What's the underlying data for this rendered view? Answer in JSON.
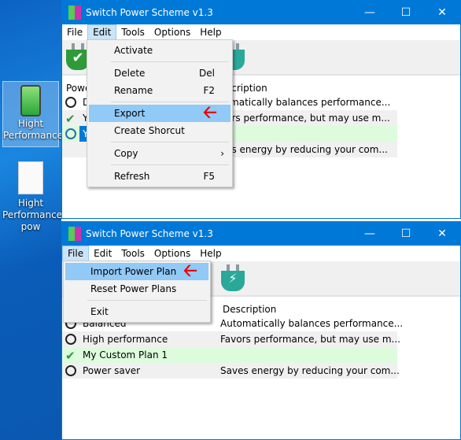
{
  "desktop": {
    "icons": [
      {
        "label": "Hight Performance",
        "icon": "battery-plug-shortcut-icon",
        "selected": true
      },
      {
        "label": "Hight Performance. pow",
        "icon": "file-icon",
        "selected": false
      }
    ]
  },
  "colors": {
    "titlebar": "#0078d7",
    "menu_highlight": "#91c9f7",
    "active_row": "#dcfcdc",
    "alt_row": "#f0f0f0",
    "arrow": "#e00000"
  },
  "top_window": {
    "title": "Switch Power Scheme v1.3",
    "menu": [
      "File",
      "Edit",
      "Tools",
      "Options",
      "Help"
    ],
    "open_menu": "Edit",
    "header": {
      "name": "Powe",
      "description": "scription"
    },
    "rows": [
      {
        "name": "D",
        "description": "tomatically balances performance...",
        "active": false
      },
      {
        "name": "Y",
        "description": "vors performance, but may use m...",
        "active": true
      },
      {
        "name": "Y",
        "description": "",
        "active": false,
        "selected": true
      },
      {
        "name": "",
        "description": "ves energy by reducing your com...",
        "active": false
      }
    ],
    "edit_menu": [
      {
        "label": "Activate",
        "shortcut": ""
      },
      {
        "sep": true
      },
      {
        "label": "Delete",
        "shortcut": "Del"
      },
      {
        "label": "Rename",
        "shortcut": "F2"
      },
      {
        "sep": true
      },
      {
        "label": "Export",
        "shortcut": "",
        "highlighted": true
      },
      {
        "label": "Create Shorcut",
        "shortcut": ""
      },
      {
        "sep": true
      },
      {
        "label": "Copy",
        "shortcut": "›"
      },
      {
        "sep": true
      },
      {
        "label": "Refresh",
        "shortcut": "F5"
      }
    ]
  },
  "bottom_window": {
    "title": "Switch Power Scheme v1.3",
    "menu": [
      "File",
      "Edit",
      "Tools",
      "Options",
      "Help"
    ],
    "open_menu": "File",
    "header": {
      "description": "Description"
    },
    "rows": [
      {
        "name": "Balanced",
        "description": "Automatically balances performance...",
        "active": false
      },
      {
        "name": "High performance",
        "description": "Favors performance, but may use m...",
        "active": false
      },
      {
        "name": "My Custom Plan 1",
        "description": "",
        "active": true
      },
      {
        "name": "Power saver",
        "description": "Saves energy by reducing your com...",
        "active": false
      }
    ],
    "file_menu": [
      {
        "label": "Import Power Plan",
        "highlighted": true
      },
      {
        "label": "Reset Power Plans"
      },
      {
        "sep": true
      },
      {
        "label": "Exit"
      }
    ]
  }
}
